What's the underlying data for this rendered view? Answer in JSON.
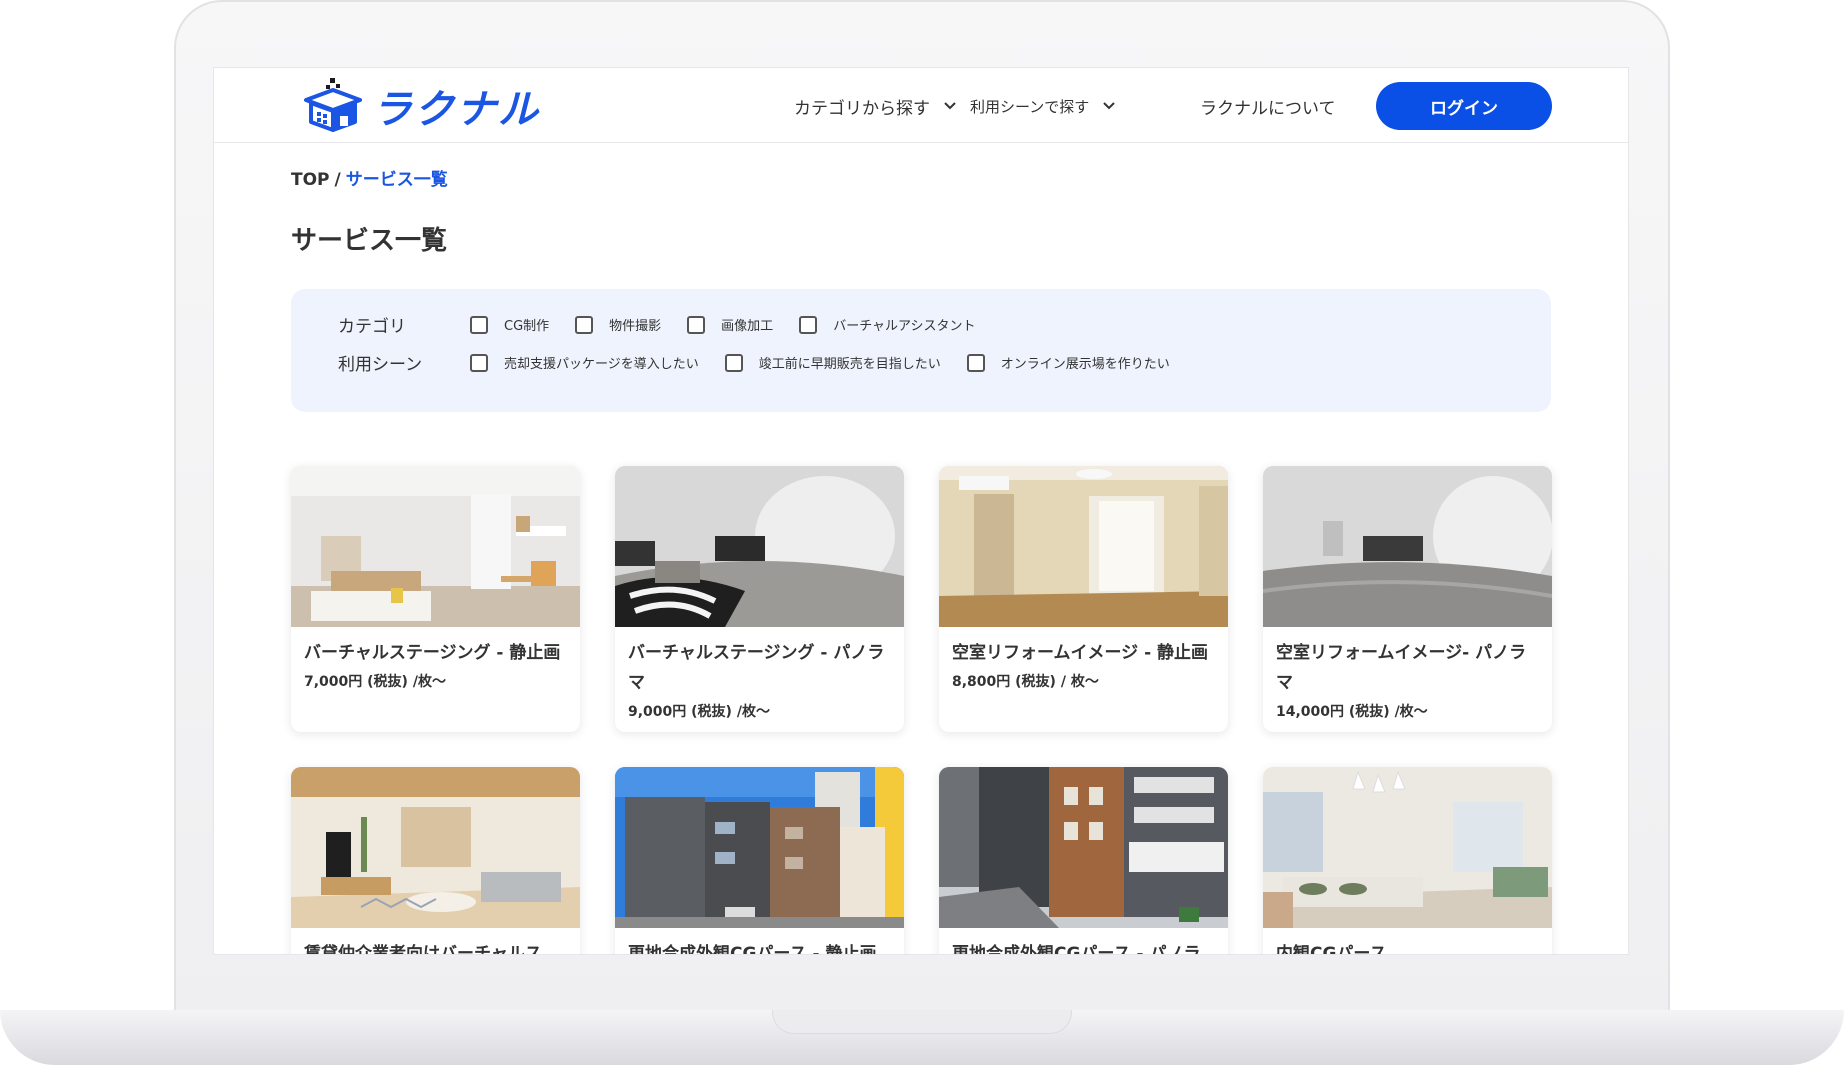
{
  "brand": {
    "logo_text": "ラクナル"
  },
  "nav": {
    "items": [
      {
        "label": "カテゴリから探す",
        "has_dropdown": true
      },
      {
        "label": "利用シーンで探す",
        "has_dropdown": true
      },
      {
        "label": "ラクナルについて",
        "has_dropdown": false
      }
    ],
    "login_label": "ログイン"
  },
  "breadcrumb": {
    "root": "TOP",
    "separator": "/",
    "current": "サービス一覧"
  },
  "page_title": "サービス一覧",
  "filters": {
    "category": {
      "label": "カテゴリ",
      "options": [
        "CG制作",
        "物件撮影",
        "画像加工",
        "バーチャルアシスタント"
      ]
    },
    "scene": {
      "label": "利用シーン",
      "options": [
        "売却支援パッケージを導入したい",
        "竣工前に早期販売を目指したい",
        "オンライン展示場を作りたい"
      ]
    }
  },
  "cards": [
    {
      "title": "バーチャルステージング - 静止画",
      "price": "7,000円 (税抜) /枚〜",
      "image": "furnished living room photo"
    },
    {
      "title": "バーチャルステージング - パノラマ",
      "price": "9,000円 (税抜) /枚〜",
      "image": "panorama furnished room"
    },
    {
      "title": "空室リフォームイメージ - 静止画",
      "price": "8,800円 (税抜) / 枚〜",
      "image": "empty room photo"
    },
    {
      "title": "空室リフォームイメージ- パノラマ",
      "price": "14,000円 (税抜) /枚〜",
      "image": "panorama empty room"
    },
    {
      "title": "賃貸仲介業者向けバーチャルス",
      "price": "",
      "image": "wood ceiling living room"
    },
    {
      "title": "更地合成外観CGパース - 静止画",
      "price": "",
      "image": "building exterior"
    },
    {
      "title": "更地合成外観CGパース - パノラ",
      "price": "",
      "image": "street building exterior"
    },
    {
      "title": "内観CGパース",
      "price": "",
      "image": "dining room render"
    }
  ],
  "colors": {
    "accent": "#0a50e6",
    "link": "#1a55e3",
    "filter_bg": "#eef3fd"
  }
}
